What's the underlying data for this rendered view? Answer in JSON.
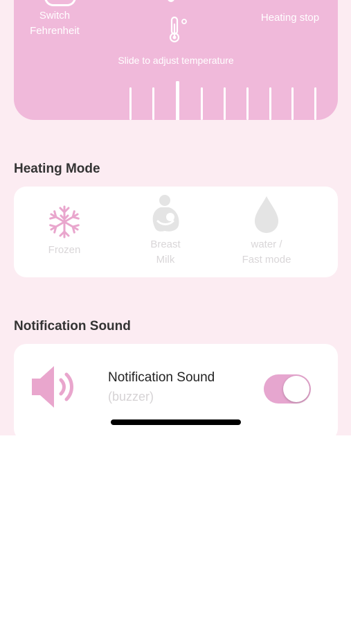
{
  "colors": {
    "accent": "#f0b9da",
    "background": "#fcecf2",
    "card": "#ffffff",
    "icon_pink": "#e9a6cd",
    "inactive_icon": "#e4e4e4",
    "toggle_on": "#e6a6cf"
  },
  "header": {
    "switch_line1": "Switch",
    "switch_line2": "Fehrenheit",
    "heating_stop": "Heating stop",
    "slide_hint": "Slide to adjust temperature",
    "thermometer_icon": "thermometer-icon"
  },
  "heating_mode": {
    "title": "Heating Mode",
    "modes": [
      {
        "icon": "snowflake-icon",
        "line1": "Frozen",
        "line2": ""
      },
      {
        "icon": "mother-baby-icon",
        "line1": "Breast",
        "line2": "Milk"
      },
      {
        "icon": "water-drop-icon",
        "line1": "water /",
        "line2": "Fast mode"
      }
    ]
  },
  "notification": {
    "section_title": "Notification Sound",
    "item_title": "Notification Sound",
    "item_subtitle": "(buzzer)",
    "speaker_icon": "speaker-icon",
    "toggle_on": true
  }
}
